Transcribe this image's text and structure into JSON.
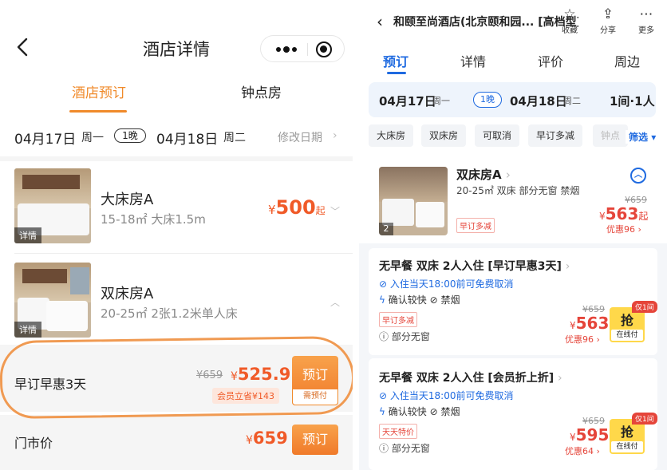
{
  "left": {
    "title": "酒店详情",
    "tabs": [
      "酒店预订",
      "钟点房"
    ],
    "dates": {
      "checkin": "04月17日",
      "checkin_week": "周一",
      "nights": "1晚",
      "checkout": "04月18日",
      "checkout_week": "周二",
      "change_label": "修改日期",
      "chevron": "›"
    },
    "rooms": [
      {
        "name": "大床房A",
        "desc": "15-18㎡  大床1.5m",
        "price_currency": "¥",
        "price": "500",
        "price_suffix": "起",
        "thumb_tag": "详情"
      },
      {
        "name": "双床房A",
        "desc": "20-25㎡  2张1.2米单人床",
        "thumb_tag": "详情"
      }
    ],
    "offers": [
      {
        "name": "早订早惠3天",
        "orig": "¥659",
        "price_currency": "¥",
        "price": "525.9",
        "member_note": "会员立省¥143",
        "book_label": "预订",
        "book_sub": "需预付"
      },
      {
        "name": "门市价",
        "price_currency": "¥",
        "price": "659",
        "book_label": "预订"
      }
    ]
  },
  "right": {
    "header": {
      "back": "‹",
      "title": "和颐至尚酒店(北京颐和园... [高档型]",
      "icons": [
        {
          "name": "star-icon",
          "glyph": "☆",
          "label": "收藏"
        },
        {
          "name": "share-icon",
          "glyph": "⇪",
          "label": "分享"
        },
        {
          "name": "more-icon",
          "glyph": "⋯",
          "label": "更多"
        }
      ]
    },
    "tabs": [
      "预订",
      "详情",
      "评价",
      "周边"
    ],
    "dates": {
      "checkin": "04月17日",
      "checkin_week": "周一",
      "nights": "1晚",
      "checkout": "04月18日",
      "checkout_week": "周二",
      "occupancy": "1间·1人"
    },
    "chips": [
      "大床房",
      "双床房",
      "可取消",
      "早订多减",
      "钟点"
    ],
    "filter_label": "筛选",
    "room": {
      "name": "双床房A",
      "desc": "20-25㎡ 双床 部分无窗 禁烟",
      "tag": "早订多减",
      "orig": "¥659",
      "price_currency": "¥",
      "price": "563",
      "price_suffix": "起",
      "discount": "优惠96",
      "thumb_count": "2"
    },
    "plans": [
      {
        "name": "无早餐 双床 2人入住 [早订早惠3天]",
        "cancel": "入住当天18:00前可免费取消",
        "confirm": "确认较快",
        "smoke": "禁烟",
        "tag": "早订多减",
        "window": "部分无窗",
        "orig": "¥659",
        "price_currency": "¥",
        "price": "563",
        "discount": "优惠96",
        "only": "仅1间",
        "grab": "抢",
        "pay": "在线付"
      },
      {
        "name": "无早餐 双床 2人入住 [会员折上折]",
        "cancel": "入住当天18:00前可免费取消",
        "confirm": "确认较快",
        "smoke": "禁烟",
        "tag": "天天特价",
        "window": "部分无窗",
        "orig": "¥659",
        "price_currency": "¥",
        "price": "595",
        "discount": "优惠64",
        "only": "仅1间",
        "grab": "抢",
        "pay": "在线付"
      }
    ]
  },
  "colors": {
    "left_accent": "#f08a2a",
    "price_red": "#f05a28",
    "right_accent": "#1f6ae0",
    "annotation_circle": "#f09a52",
    "grab_yellow": "#ffd84a"
  }
}
